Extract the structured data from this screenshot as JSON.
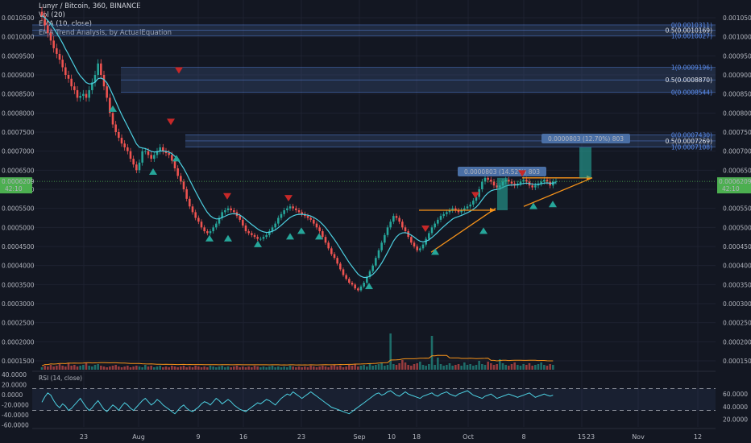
{
  "header": {
    "symbol": "Lunyr / Bitcoin, 360, BINANCE",
    "vol": "Vol (20)",
    "ema": "EMA (10, close)",
    "study": "EMA Trend Analysis, by ActualEquation",
    "rsi": "RSI (14, close)"
  },
  "colors": {
    "background": "#131722",
    "up": "#26a69a",
    "down": "#ef5350",
    "ema": "#4dd0e1",
    "fib_band": "#3a4f7a",
    "fib_text": "#5b8def",
    "arrow": "#f7931a",
    "entry": "#26a69a",
    "exit": "#c62828",
    "signal_text": "#d4d43a",
    "price_tag": "#4caf50"
  },
  "chart_data": {
    "type": "candlestick",
    "price_axis_left": [
      "0.0010500",
      "0.0010000",
      "0.0009500",
      "0.0009000",
      "0.0008500",
      "0.0008000",
      "0.0007500",
      "0.0007000",
      "0.0006500",
      "0.0006000",
      "0.0005500",
      "0.0005000",
      "0.0004500",
      "0.0004000",
      "0.0003500",
      "0.0003000",
      "0.0002500",
      "0.0002000",
      "0.0001500"
    ],
    "price_axis_right": [
      "0.0010500",
      "0.0010000",
      "0.0009500",
      "0.0009000",
      "0.0008500",
      "0.0008000",
      "0.0007500",
      "0.0007000",
      "0.0006500",
      "0.0006000",
      "0.0005500",
      "0.0005000",
      "0.0004500",
      "0.0004000",
      "0.0003500",
      "0.0003000",
      "0.0002500",
      "0.0002000",
      "0.0001500"
    ],
    "ylim": [
      0.000125,
      0.00106
    ],
    "x_ticks": [
      "23",
      "Aug",
      "9",
      "16",
      "23",
      "Sep",
      "10",
      "18",
      "Oct",
      "8",
      "15",
      "23",
      "Nov",
      "12"
    ],
    "current_price": "0.0006209",
    "countdown": "42:10",
    "fib_levels": [
      {
        "label": "0(0.0010311)",
        "value": 0.0010311
      },
      {
        "label": "0.5(0.0010169)",
        "value": 0.0010169
      },
      {
        "label": "1(0.0010027)",
        "value": 0.0010027
      },
      {
        "label": "1(0.0009196)",
        "value": 0.0009196
      },
      {
        "label": "0.5(0.0008870)",
        "value": 0.000887
      },
      {
        "label": "0(0.0008544)",
        "value": 0.0008544
      },
      {
        "label": "0(0.0007430)",
        "value": 0.000743
      },
      {
        "label": "0.5(0.0007269)",
        "value": 0.0007269
      },
      {
        "label": "1(0.0007108)",
        "value": 0.0007108
      }
    ],
    "measurements": [
      {
        "label": "0.0000803 (14.52%) 803"
      },
      {
        "label": "0.0000803 (12.70%) 803"
      }
    ],
    "close_series": [
      0.001055,
      0.00103,
      0.00101,
      0.00099,
      0.00097,
      0.000955,
      0.00094,
      0.00092,
      0.0009,
      0.00089,
      0.00087,
      0.00086,
      0.00084,
      0.000845,
      0.00085,
      0.00084,
      0.00086,
      0.00088,
      0.0009,
      0.00093,
      0.0009,
      0.00087,
      0.00084,
      0.0008,
      0.00077,
      0.00075,
      0.000735,
      0.00072,
      0.00071,
      0.0007,
      0.00068,
      0.000665,
      0.00065,
      0.00067,
      0.0007,
      0.0007,
      0.00069,
      0.00068,
      0.00069,
      0.0007,
      0.00071,
      0.0007,
      0.000695,
      0.00069,
      0.000675,
      0.000655,
      0.000635,
      0.00062,
      0.0006,
      0.000575,
      0.000555,
      0.00054,
      0.000525,
      0.000515,
      0.0005,
      0.00049,
      0.000485,
      0.00049,
      0.0005,
      0.00051,
      0.000525,
      0.00054,
      0.000545,
      0.00055,
      0.000545,
      0.00054,
      0.00053,
      0.00052,
      0.000505,
      0.00049,
      0.000485,
      0.00048,
      0.000475,
      0.00047,
      0.00047,
      0.000475,
      0.00048,
      0.00049,
      0.0005,
      0.00051,
      0.000525,
      0.000535,
      0.000545,
      0.00055,
      0.000555,
      0.00055,
      0.000545,
      0.00054,
      0.000535,
      0.00053,
      0.000525,
      0.00052,
      0.00051,
      0.0005,
      0.00049,
      0.000475,
      0.00046,
      0.000445,
      0.00043,
      0.00042,
      0.000405,
      0.00039,
      0.000375,
      0.000365,
      0.000355,
      0.00035,
      0.00034,
      0.000335,
      0.000345,
      0.000355,
      0.00037,
      0.000385,
      0.0004,
      0.00042,
      0.00044,
      0.00046,
      0.00048,
      0.0005,
      0.000515,
      0.00053,
      0.000525,
      0.000515,
      0.0005,
      0.00049,
      0.000475,
      0.00046,
      0.00045,
      0.00044,
      0.000445,
      0.000455,
      0.00047,
      0.000485,
      0.0005,
      0.00051,
      0.00052,
      0.00053,
      0.000535,
      0.00054,
      0.000545,
      0.00055,
      0.000545,
      0.00054,
      0.000545,
      0.00055,
      0.000555,
      0.00056,
      0.00057,
      0.00058,
      0.0006,
      0.00062,
      0.00063,
      0.000625,
      0.00062,
      0.00061,
      0.000605,
      0.00061,
      0.00062,
      0.000625,
      0.00062,
      0.000615,
      0.00061,
      0.000615,
      0.00062,
      0.000625,
      0.00062,
      0.00061,
      0.000605,
      0.00061,
      0.000615,
      0.00062,
      0.000625,
      0.00062,
      0.00061,
      0.00062,
      0.0006209
    ],
    "volume_series": [
      0.3,
      0.5,
      0.4,
      0.6,
      0.4,
      0.5,
      0.7,
      0.5,
      0.4,
      0.8,
      0.5,
      0.6,
      0.4,
      0.5,
      0.6,
      0.9,
      0.5,
      0.4,
      0.6,
      0.7,
      0.5,
      0.4,
      0.3,
      0.4,
      0.5,
      0.6,
      0.4,
      0.3,
      0.4,
      0.5,
      0.3,
      0.4,
      0.5,
      0.4,
      0.3,
      0.6,
      0.4,
      0.5,
      0.3,
      0.4,
      0.5,
      0.3,
      0.4,
      0.3,
      0.5,
      0.4,
      0.3,
      0.4,
      0.5,
      0.3,
      0.4,
      0.3,
      0.5,
      0.4,
      0.3,
      0.4,
      0.3,
      0.5,
      0.4,
      0.3,
      0.4,
      0.5,
      0.3,
      0.4,
      0.3,
      0.4,
      0.5,
      0.3,
      0.4,
      0.3,
      0.4,
      0.3,
      0.5,
      0.4,
      0.3,
      0.4,
      0.3,
      0.4,
      0.5,
      0.3,
      0.4,
      0.3,
      0.4,
      0.3,
      0.5,
      0.4,
      0.3,
      0.4,
      0.3,
      0.4,
      0.3,
      0.5,
      0.4,
      0.3,
      0.4,
      0.5,
      0.4,
      0.3,
      0.5,
      0.6,
      0.4,
      0.5,
      0.3,
      0.4,
      0.6,
      0.5,
      0.7,
      0.4,
      0.5,
      0.6,
      0.4,
      0.8,
      0.5,
      0.6,
      0.7,
      0.9,
      0.5,
      0.6,
      4.5,
      0.7,
      0.6,
      0.8,
      1.2,
      0.9,
      0.6,
      0.5,
      0.7,
      0.8,
      1.0,
      0.6,
      0.5,
      0.7,
      4.2,
      0.6,
      1.5,
      0.7,
      0.5,
      0.6,
      0.8,
      0.5,
      0.6,
      0.7,
      0.5,
      0.9,
      0.6,
      0.7,
      0.5,
      0.6,
      1.1,
      0.7,
      0.6,
      1.0,
      0.8,
      0.6,
      0.7,
      1.3,
      0.8,
      0.6,
      0.5,
      0.7,
      0.9,
      0.6,
      0.5,
      0.7,
      0.6,
      0.8,
      0.5,
      0.6,
      0.7,
      0.9,
      0.6,
      0.5,
      0.7,
      0.6
    ],
    "rsi_axis_left": [
      "40.0000",
      "20.0000",
      "0.0000",
      "-20.0000",
      "-40.0000",
      "-60.0000"
    ],
    "rsi_axis_right": [
      "60.0000",
      "40.0000",
      "20.0000"
    ],
    "rsi_series": [
      45,
      55,
      62,
      58,
      48,
      40,
      35,
      42,
      38,
      30,
      34,
      40,
      46,
      52,
      44,
      36,
      30,
      35,
      42,
      48,
      40,
      32,
      28,
      34,
      40,
      36,
      30,
      38,
      44,
      40,
      34,
      30,
      36,
      42,
      48,
      52,
      46,
      40,
      44,
      50,
      46,
      40,
      36,
      32,
      28,
      24,
      30,
      36,
      40,
      34,
      30,
      28,
      32,
      36,
      42,
      46,
      44,
      40,
      46,
      52,
      48,
      42,
      46,
      50,
      46,
      40,
      36,
      32,
      30,
      28,
      32,
      36,
      40,
      44,
      42,
      46,
      50,
      48,
      44,
      40,
      46,
      52,
      56,
      60,
      58,
      64,
      60,
      56,
      52,
      56,
      60,
      64,
      60,
      56,
      52,
      48,
      44,
      40,
      36,
      34,
      32,
      30,
      28,
      26,
      24,
      28,
      32,
      36,
      40,
      44,
      48,
      52,
      56,
      60,
      62,
      58,
      60,
      64,
      66,
      62,
      58,
      56,
      60,
      64,
      60,
      58,
      56,
      54,
      52,
      56,
      58,
      60,
      62,
      58,
      56,
      60,
      62,
      64,
      60,
      58,
      56,
      60,
      62,
      64,
      66,
      62,
      58,
      56,
      54,
      52,
      56,
      58,
      60,
      56,
      52,
      54,
      56,
      58,
      60,
      58,
      56,
      54,
      56,
      58,
      60,
      62,
      58,
      54,
      56,
      58,
      60,
      58,
      56,
      58
    ]
  }
}
